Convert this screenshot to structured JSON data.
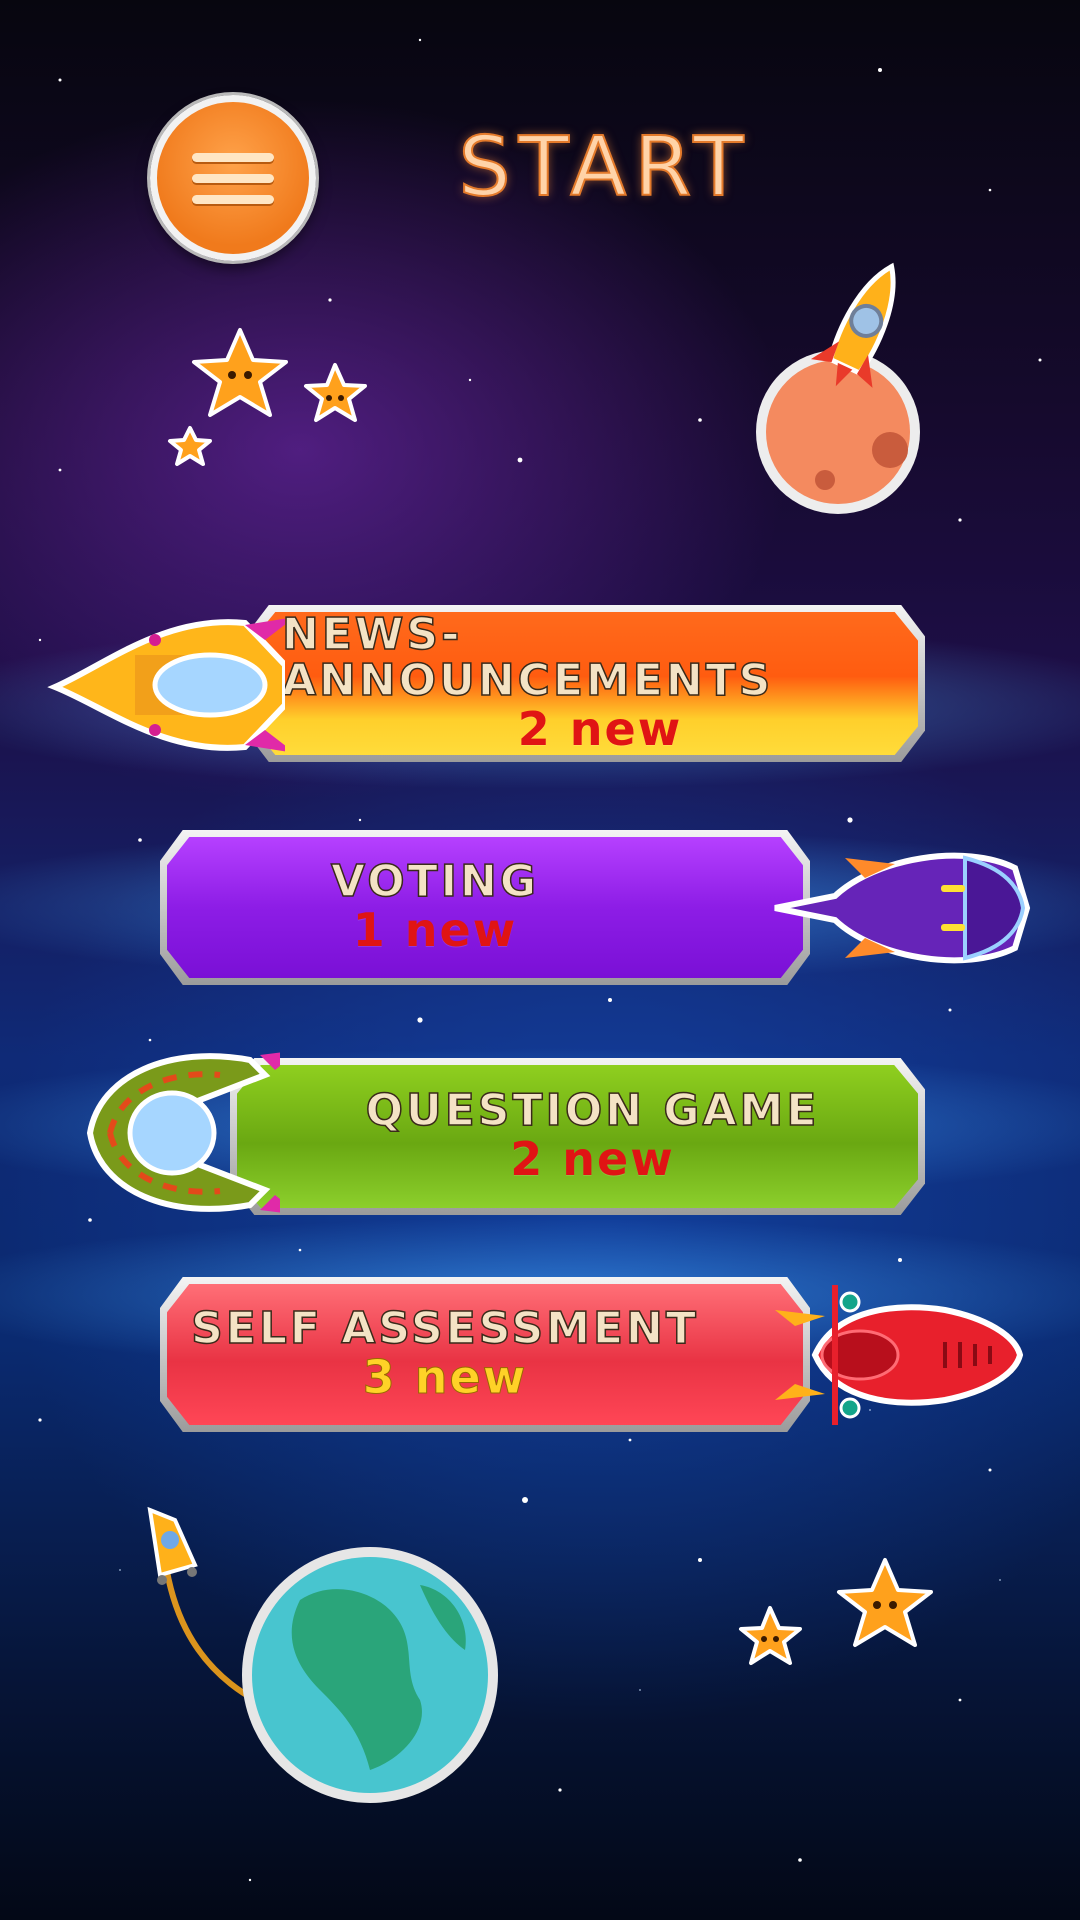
{
  "header": {
    "title": "START"
  },
  "menu": [
    {
      "title": "NEWS-ANNOUNCEMENTS",
      "badge": "2 new"
    },
    {
      "title": "VOTING",
      "badge": "1 new"
    },
    {
      "title": "QUESTION GAME",
      "badge": "2 new"
    },
    {
      "title": "SELF ASSESSMENT",
      "badge": "3 new"
    }
  ],
  "icons": [
    "menu-icon",
    "star-icon",
    "rocket-icon",
    "planet-icon",
    "spaceship-icon",
    "earth-icon"
  ],
  "colors": {
    "menu_button": "#f07a1c",
    "news": "#ff6a1c",
    "voting": "#8d1de6",
    "question_game": "#6aa812",
    "self_assessment": "#e93344",
    "badge_red": "#e01414",
    "badge_gold": "#ffd227"
  }
}
